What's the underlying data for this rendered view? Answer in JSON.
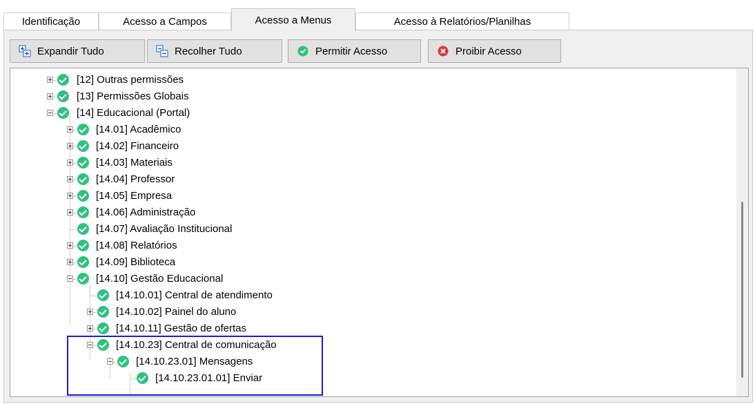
{
  "tabs": [
    {
      "label": "Identificação"
    },
    {
      "label": "Acesso a Campos"
    },
    {
      "label": "Acesso a Menus"
    },
    {
      "label": "Acesso à Relatórios/Planilhas"
    }
  ],
  "active_tab": "Acesso a Menus",
  "toolbar": {
    "expand_label": "Expandir Tudo",
    "collapse_label": "Recolher Tudo",
    "allow_label": "Permitir Acesso",
    "deny_label": "Proibir Acesso"
  },
  "tree": {
    "items": [
      {
        "label": "[12] Outras permissões",
        "state": "collapsed"
      },
      {
        "label": "[13] Permissões Globais",
        "state": "collapsed"
      },
      {
        "label": "[14] Educacional (Portal)",
        "state": "expanded"
      },
      {
        "label": "[14.01] Acadêmico",
        "state": "collapsed"
      },
      {
        "label": "[14.02] Financeiro",
        "state": "collapsed"
      },
      {
        "label": "[14.03] Materiais",
        "state": "collapsed"
      },
      {
        "label": "[14.04] Professor",
        "state": "collapsed"
      },
      {
        "label": "[14.05] Empresa",
        "state": "collapsed"
      },
      {
        "label": "[14.06] Administração",
        "state": "collapsed"
      },
      {
        "label": "[14.07] Avaliação Institucional",
        "state": "leaf"
      },
      {
        "label": "[14.08] Relatórios",
        "state": "collapsed"
      },
      {
        "label": "[14.09] Biblioteca",
        "state": "collapsed"
      },
      {
        "label": "[14.10] Gestão Educacional",
        "state": "expanded"
      },
      {
        "label": "[14.10.01] Central de atendimento",
        "state": "leaf"
      },
      {
        "label": "[14.10.02] Painel do aluno",
        "state": "collapsed"
      },
      {
        "label": "[14.10.11] Gestão de ofertas",
        "state": "collapsed"
      },
      {
        "label": "[14.10.23] Central de comunicação",
        "state": "expanded"
      },
      {
        "label": "[14.10.23.01] Mensagens",
        "state": "expanded"
      },
      {
        "label": "[14.10.23.01.01] Enviar",
        "state": "leaf"
      }
    ]
  },
  "colors": {
    "check": "#2ec27e",
    "highlight": "#1a1adc",
    "deny": "#d9363e"
  }
}
